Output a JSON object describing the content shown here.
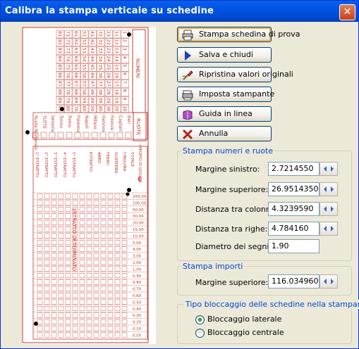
{
  "window": {
    "title": "Calibra la stampa verticale su schedine",
    "close_glyph": "✕"
  },
  "ticket": {
    "header_numbers": "NUMERI",
    "header_ruote": "RUOTE",
    "header_importo": "IMPORTO DI GIOCATA",
    "label_totale": "TOTALE",
    "euro_symbol": "€",
    "wheels": [
      "Bari",
      "Cagliari",
      "Firenze",
      "Genova",
      "Milano",
      "Napoli",
      "Palermo",
      "Roma",
      "Torino",
      "Venezia",
      "TUTTE",
      "Ruota Nazionale"
    ],
    "estratti": [
      "1° ESTRATTO",
      "2° ESTRATTO",
      "3° ESTRATTO",
      "4° ESTRATTO",
      "5° ESTRATTO"
    ],
    "bets": [
      "ESTRATTO",
      "AMBO",
      "TERNO",
      "QUATERNA",
      "CINQUINA"
    ],
    "estratto_determinato": "ESTRATTO DETERMINATO",
    "amounts": [
      "200,00",
      "100,00",
      "50,00",
      "30,00",
      "20,00",
      "15,00",
      "10,00",
      "5,00",
      "4,00",
      "3,00",
      "2,00",
      "1,00",
      "0,90",
      "0,80",
      "0,70",
      "0,60",
      "0,50",
      "0,40",
      "0,30",
      "0,20",
      "0,10",
      "0,05"
    ],
    "number_rows": [
      [
        "1",
        "2",
        "3",
        "4",
        "5",
        "6",
        "7",
        "8",
        "9",
        "10"
      ],
      [
        "11",
        "12",
        "13",
        "14",
        "15",
        "16",
        "17",
        "18",
        "19",
        "20"
      ],
      [
        "21",
        "22",
        "23",
        "24",
        "25",
        "26",
        "27",
        "28",
        "29",
        "30"
      ],
      [
        "31",
        "32",
        "33",
        "34",
        "35",
        "36",
        "37",
        "38",
        "39",
        "40"
      ],
      [
        "41",
        "42",
        "43",
        "44",
        "45",
        "46",
        "47",
        "48",
        "49",
        "50"
      ],
      [
        "51",
        "52",
        "53",
        "54",
        "55",
        "56",
        "57",
        "58",
        "59",
        "60"
      ],
      [
        "61",
        "62",
        "63",
        "64",
        "65",
        "66",
        "67",
        "68",
        "69",
        "70"
      ],
      [
        "71",
        "72",
        "73",
        "74",
        "75",
        "76",
        "77",
        "78",
        "79",
        "80"
      ],
      [
        "81",
        "82",
        "83",
        "84",
        "85",
        "86",
        "87",
        "88",
        "89",
        "90"
      ]
    ],
    "colors": {
      "ink": "#c0392b",
      "mark": "#000000"
    }
  },
  "buttons": [
    {
      "label": "Stampa schedina di prova",
      "icon": "printer-icon"
    },
    {
      "label": "Salva e chiudi",
      "icon": "play-arrow-icon"
    },
    {
      "label": "Ripristina valori originali",
      "icon": "undo-brush-icon"
    },
    {
      "label": "Imposta stampante",
      "icon": "printer-settings-icon"
    },
    {
      "label": "Guida in linea",
      "icon": "help-book-icon"
    },
    {
      "label": "Annulla",
      "icon": "cancel-x-icon"
    }
  ],
  "group_numeri": {
    "title": "Stampa numeri e ruote",
    "fields": [
      {
        "label": "Margine sinistro:",
        "value": "2.7214550"
      },
      {
        "label": "Margine superiore:",
        "value": "26.9514350"
      },
      {
        "label": "Distanza tra colonne:",
        "value": "4.3239590"
      },
      {
        "label": "Distanza tra righe:",
        "value": "4.784160"
      },
      {
        "label": "Diametro dei segni:",
        "value": "1.90"
      }
    ]
  },
  "group_importi": {
    "title": "Stampa importi",
    "fields": [
      {
        "label": "Margine superiore:",
        "value": "116.034960"
      }
    ]
  },
  "group_blocco": {
    "title": "Tipo bloccaggio delle schedine nella stampante",
    "options": [
      {
        "label": "Bloccaggio laterale",
        "selected": true
      },
      {
        "label": "Bloccaggio centrale",
        "selected": false
      }
    ]
  }
}
